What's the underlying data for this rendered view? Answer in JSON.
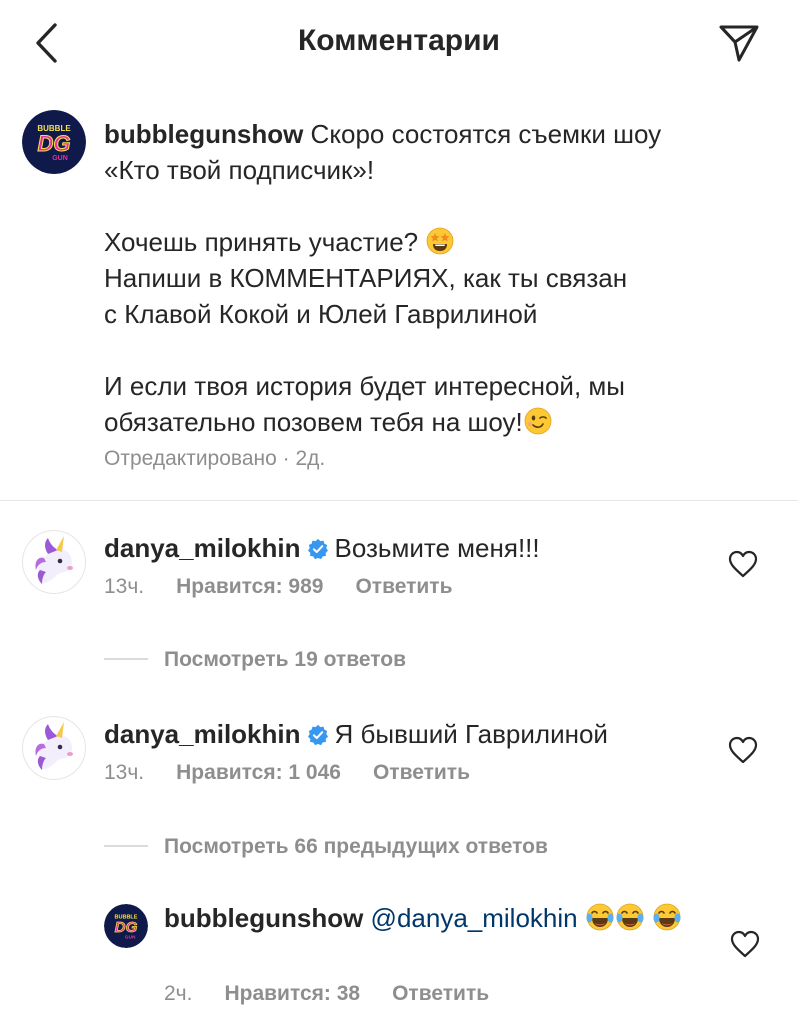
{
  "header": {
    "title": "Комментарии"
  },
  "caption": {
    "username": "bubblegunshow",
    "logo_text_top": "BUBBLE",
    "logo_text_main": "DG",
    "logo_text_bottom": "GUN",
    "line1": "Скоро состоятся съемки шоу",
    "line2": "«Кто твой подписчик»!",
    "line3": "Хочешь принять участие?",
    "line4": "Напиши в КОММЕНТАРИЯХ, как ты связан",
    "line5": "с Клавой Кокой и Юлей Гаврилиной",
    "line6": "И если твоя история будет интересной, мы",
    "line7": "обязательно позовем тебя на шоу!",
    "meta": "Отредактировано · 2д."
  },
  "comments": [
    {
      "username": "danya_milokhin",
      "text": "Возьмите меня!!!",
      "time": "13ч.",
      "likes": "Нравится: 989",
      "reply": "Ответить",
      "view_replies": "Посмотреть 19 ответов"
    },
    {
      "username": "danya_milokhin",
      "text": "Я бывший Гаврилиной",
      "time": "13ч.",
      "likes": "Нравится: 1 046",
      "reply": "Ответить",
      "view_replies": "Посмотреть 66 предыдущих ответов"
    }
  ],
  "reply": {
    "username": "bubblegunshow",
    "mention": "@danya_milokhin",
    "time": "2ч.",
    "likes": "Нравится: 38",
    "reply": "Ответить"
  },
  "colors": {
    "text": "#262626",
    "secondary": "#8e8e8e",
    "mention": "#00376b",
    "verified": "#3897f0",
    "logo_bg": "#101a4a",
    "logo_pink": "#e62fa0",
    "logo_yellow": "#f4e04d"
  },
  "icons": {
    "back": "chevron-left-icon",
    "send": "paper-plane-icon",
    "verified": "verified-badge-icon",
    "like": "heart-outline-icon",
    "star_struck": "star-struck-emoji-icon",
    "wink": "winking-face-emoji-icon",
    "laugh": "tears-of-joy-emoji-icon",
    "unicorn": "unicorn-avatar-icon"
  }
}
